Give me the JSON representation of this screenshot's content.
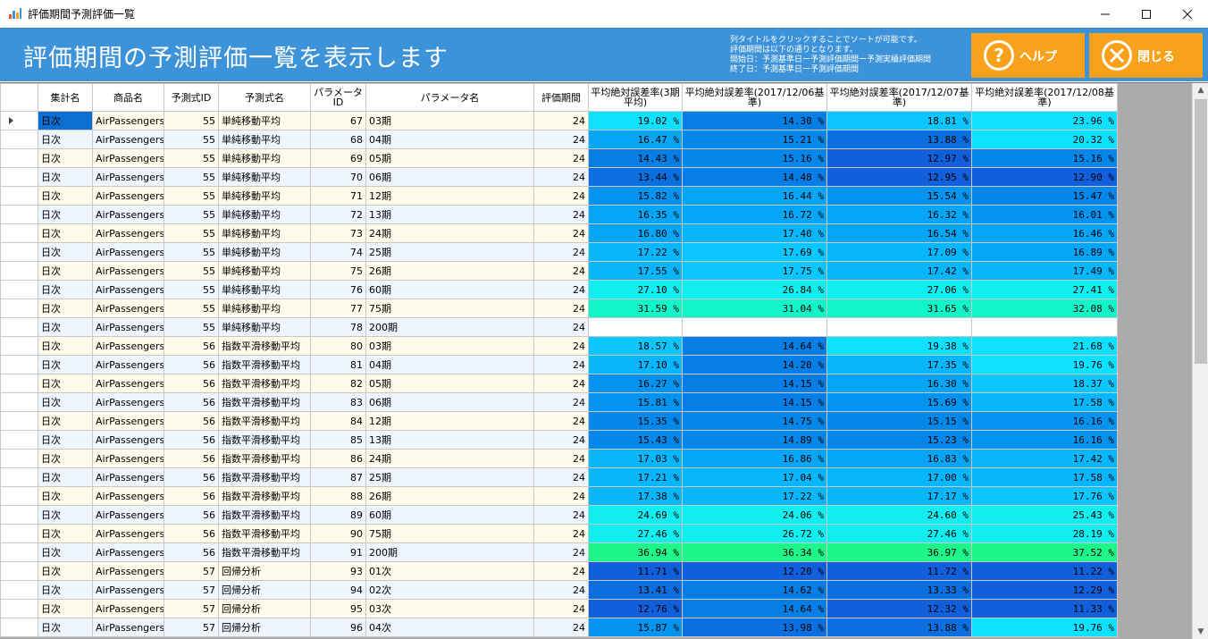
{
  "window": {
    "title": "評価期間予測評価一覧"
  },
  "header": {
    "title": "評価期間の予測評価一覧を表示します",
    "notes": [
      "列タイトルをクリックすることでソートが可能です。",
      "評価期間は以下の通りとなります。",
      "開始日：予測基準日ー予測評価期間ー予測実績評価期間",
      "終了日：予測基準日ー予測評価期間"
    ],
    "help_label": "ヘルプ",
    "close_label": "閉じる"
  },
  "colors": {
    "header_bg": "#3d93d9",
    "button_bg": "#f7a21a",
    "selected_cell": "#0a6fd1"
  },
  "grid": {
    "columns": [
      "集計名",
      "商品名",
      "予測式ID",
      "予測式名",
      "パラメータID",
      "パラメータ名",
      "評価期間",
      "平均絶対誤差率(3期平均)",
      "平均絶対誤差率(2017/12/06基準)",
      "平均絶対誤差率(2017/12/07基準)",
      "平均絶対誤差率(2017/12/08基準)"
    ],
    "rows": [
      [
        "日次",
        "AirPassengers",
        "55",
        "単純移動平均",
        "67",
        "03期",
        "24",
        "19.02 %",
        "14.30 %",
        "18.81 %",
        "23.96 %"
      ],
      [
        "日次",
        "AirPassengers",
        "55",
        "単純移動平均",
        "68",
        "04期",
        "24",
        "16.47 %",
        "15.21 %",
        "13.88 %",
        "20.32 %"
      ],
      [
        "日次",
        "AirPassengers",
        "55",
        "単純移動平均",
        "69",
        "05期",
        "24",
        "14.43 %",
        "15.16 %",
        "12.97 %",
        "15.16 %"
      ],
      [
        "日次",
        "AirPassengers",
        "55",
        "単純移動平均",
        "70",
        "06期",
        "24",
        "13.44 %",
        "14.48 %",
        "12.95 %",
        "12.90 %"
      ],
      [
        "日次",
        "AirPassengers",
        "55",
        "単純移動平均",
        "71",
        "12期",
        "24",
        "15.82 %",
        "16.44 %",
        "15.54 %",
        "15.47 %"
      ],
      [
        "日次",
        "AirPassengers",
        "55",
        "単純移動平均",
        "72",
        "13期",
        "24",
        "16.35 %",
        "16.72 %",
        "16.32 %",
        "16.01 %"
      ],
      [
        "日次",
        "AirPassengers",
        "55",
        "単純移動平均",
        "73",
        "24期",
        "24",
        "16.80 %",
        "17.40 %",
        "16.54 %",
        "16.46 %"
      ],
      [
        "日次",
        "AirPassengers",
        "55",
        "単純移動平均",
        "74",
        "25期",
        "24",
        "17.22 %",
        "17.69 %",
        "17.09 %",
        "16.89 %"
      ],
      [
        "日次",
        "AirPassengers",
        "55",
        "単純移動平均",
        "75",
        "26期",
        "24",
        "17.55 %",
        "17.75 %",
        "17.42 %",
        "17.49 %"
      ],
      [
        "日次",
        "AirPassengers",
        "55",
        "単純移動平均",
        "76",
        "60期",
        "24",
        "27.10 %",
        "26.84 %",
        "27.06 %",
        "27.41 %"
      ],
      [
        "日次",
        "AirPassengers",
        "55",
        "単純移動平均",
        "77",
        "75期",
        "24",
        "31.59 %",
        "31.04 %",
        "31.65 %",
        "32.08 %"
      ],
      [
        "日次",
        "AirPassengers",
        "55",
        "単純移動平均",
        "78",
        "200期",
        "24",
        "",
        "",
        "",
        ""
      ],
      [
        "日次",
        "AirPassengers",
        "56",
        "指数平滑移動平均",
        "80",
        "03期",
        "24",
        "18.57 %",
        "14.64 %",
        "19.38 %",
        "21.68 %"
      ],
      [
        "日次",
        "AirPassengers",
        "56",
        "指数平滑移動平均",
        "81",
        "04期",
        "24",
        "17.10 %",
        "14.20 %",
        "17.35 %",
        "19.76 %"
      ],
      [
        "日次",
        "AirPassengers",
        "56",
        "指数平滑移動平均",
        "82",
        "05期",
        "24",
        "16.27 %",
        "14.15 %",
        "16.30 %",
        "18.37 %"
      ],
      [
        "日次",
        "AirPassengers",
        "56",
        "指数平滑移動平均",
        "83",
        "06期",
        "24",
        "15.81 %",
        "14.15 %",
        "15.69 %",
        "17.58 %"
      ],
      [
        "日次",
        "AirPassengers",
        "56",
        "指数平滑移動平均",
        "84",
        "12期",
        "24",
        "15.35 %",
        "14.75 %",
        "15.15 %",
        "16.16 %"
      ],
      [
        "日次",
        "AirPassengers",
        "56",
        "指数平滑移動平均",
        "85",
        "13期",
        "24",
        "15.43 %",
        "14.89 %",
        "15.23 %",
        "16.16 %"
      ],
      [
        "日次",
        "AirPassengers",
        "56",
        "指数平滑移動平均",
        "86",
        "24期",
        "24",
        "17.03 %",
        "16.86 %",
        "16.83 %",
        "17.42 %"
      ],
      [
        "日次",
        "AirPassengers",
        "56",
        "指数平滑移動平均",
        "87",
        "25期",
        "24",
        "17.21 %",
        "17.04 %",
        "17.00 %",
        "17.58 %"
      ],
      [
        "日次",
        "AirPassengers",
        "56",
        "指数平滑移動平均",
        "88",
        "26期",
        "24",
        "17.38 %",
        "17.22 %",
        "17.17 %",
        "17.76 %"
      ],
      [
        "日次",
        "AirPassengers",
        "56",
        "指数平滑移動平均",
        "89",
        "60期",
        "24",
        "24.69 %",
        "24.06 %",
        "24.60 %",
        "25.43 %"
      ],
      [
        "日次",
        "AirPassengers",
        "56",
        "指数平滑移動平均",
        "90",
        "75期",
        "24",
        "27.46 %",
        "26.72 %",
        "27.46 %",
        "28.19 %"
      ],
      [
        "日次",
        "AirPassengers",
        "56",
        "指数平滑移動平均",
        "91",
        "200期",
        "24",
        "36.94 %",
        "36.34 %",
        "36.97 %",
        "37.52 %"
      ],
      [
        "日次",
        "AirPassengers",
        "57",
        "回帰分析",
        "93",
        "01次",
        "24",
        "11.71 %",
        "12.20 %",
        "11.72 %",
        "11.22 %"
      ],
      [
        "日次",
        "AirPassengers",
        "57",
        "回帰分析",
        "94",
        "02次",
        "24",
        "13.41 %",
        "14.62 %",
        "13.33 %",
        "12.29 %"
      ],
      [
        "日次",
        "AirPassengers",
        "57",
        "回帰分析",
        "95",
        "03次",
        "24",
        "12.76 %",
        "14.64 %",
        "12.32 %",
        "11.33 %"
      ],
      [
        "日次",
        "AirPassengers",
        "57",
        "回帰分析",
        "96",
        "04次",
        "24",
        "15.87 %",
        "13.98 %",
        "13.88 %",
        "19.76 %"
      ]
    ]
  }
}
